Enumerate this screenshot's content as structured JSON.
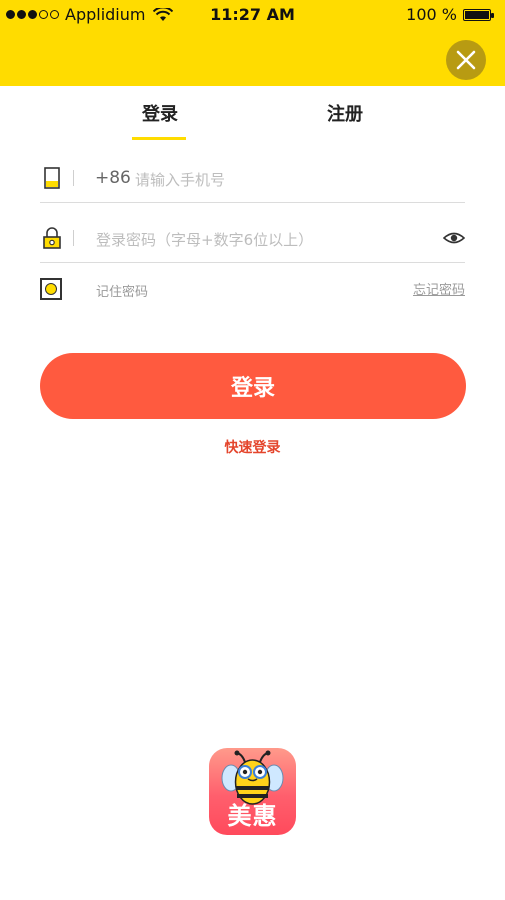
{
  "status_bar": {
    "carrier": "Applidium",
    "time": "11:27 AM",
    "battery_text": "100 %"
  },
  "header": {
    "close_icon": "close-icon",
    "accent_color": "#ffdc00"
  },
  "tabs": {
    "login": "登录",
    "register": "注册",
    "active": "login"
  },
  "phone_field": {
    "prefix": "+86",
    "placeholder": "请输入手机号",
    "value": "",
    "icon": "phone-icon"
  },
  "password_field": {
    "placeholder": "登录密码（字母+数字6位以上）",
    "value": "",
    "icon": "lock-icon",
    "toggle_icon": "eye-icon"
  },
  "remember": {
    "label": "记住密码",
    "forgot_label": "忘记密码"
  },
  "login_button": {
    "label": "登录",
    "color": "#ff5a3f"
  },
  "quick_login": {
    "label": "快速登录"
  },
  "app_logo": {
    "brand_text": "美惠"
  }
}
